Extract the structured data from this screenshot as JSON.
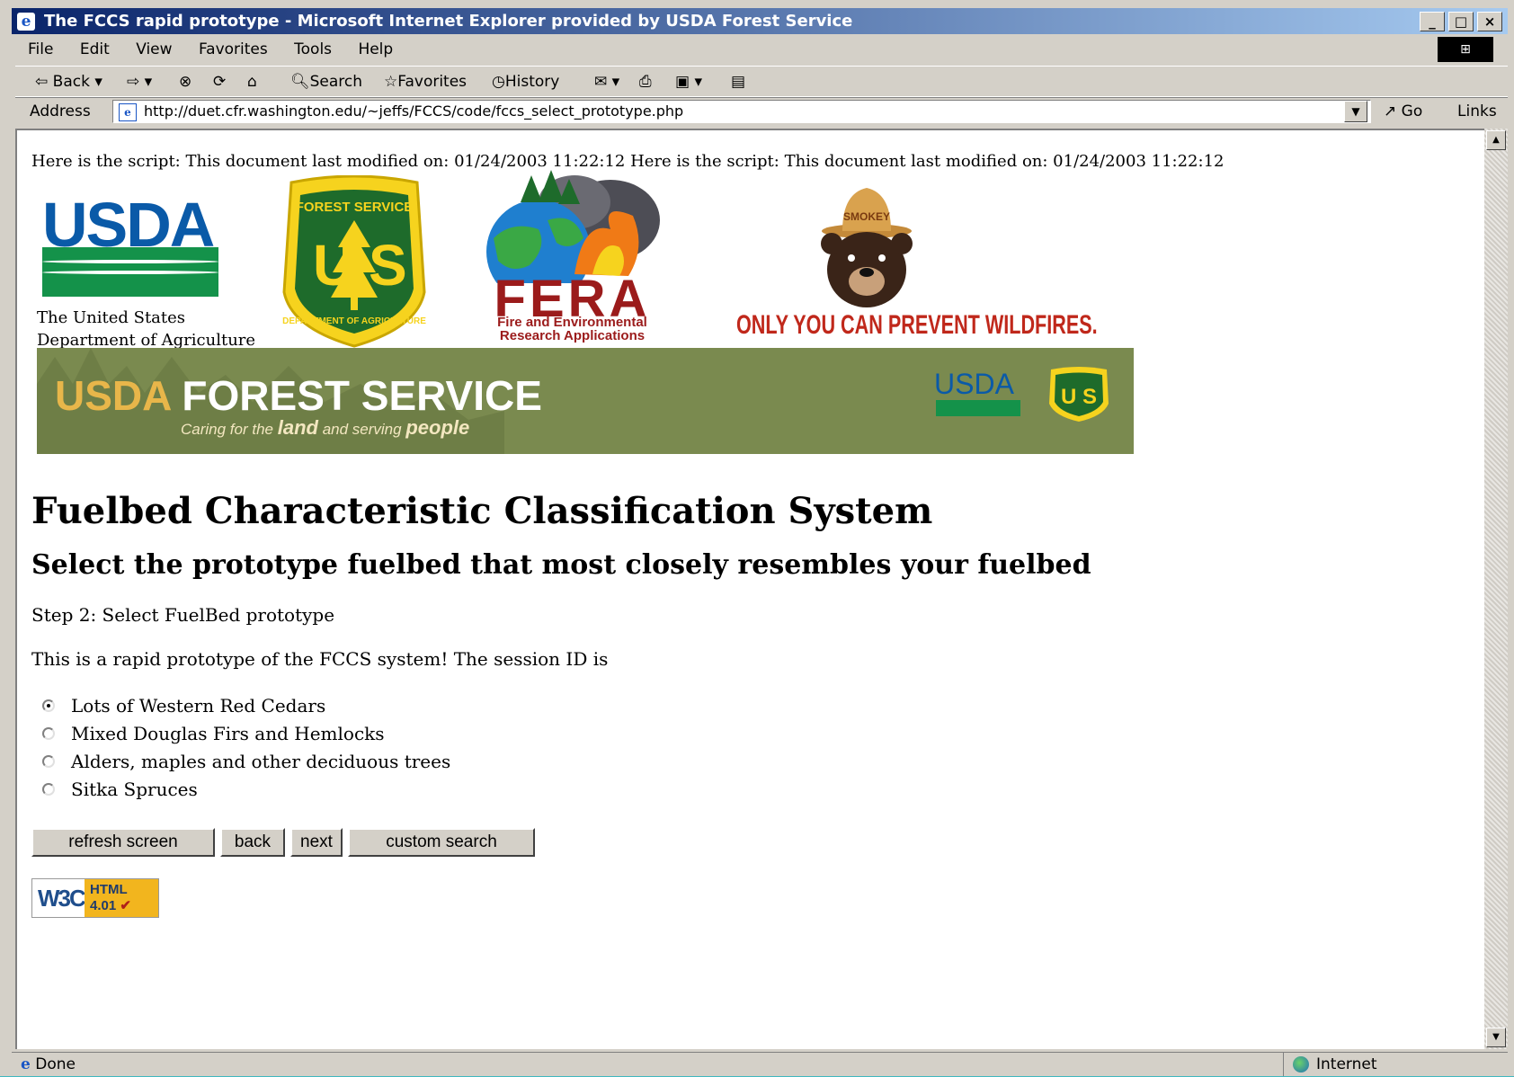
{
  "window": {
    "title": "The FCCS rapid prototype - Microsoft Internet Explorer provided by USDA Forest Service",
    "controls": [
      "_",
      "□",
      "×"
    ]
  },
  "menu": [
    "File",
    "Edit",
    "View",
    "Favorites",
    "Tools",
    "Help"
  ],
  "toolbar": {
    "back": "Back",
    "search": "Search",
    "favorites": "Favorites",
    "history": "History"
  },
  "address": {
    "label": "Address",
    "url": "http://duet.cfr.washington.edu/~jeffs/FCCS/code/fccs_select_prototype.php",
    "go": "Go",
    "links": "Links"
  },
  "page": {
    "modified_line": "Here is the script: This document last modified on: 01/24/2003 11:22:12 Here is the script: This document last modified on: 01/24/2003 11:22:12",
    "usda_logo": "USDA",
    "usda_caption_1": "The United States",
    "usda_caption_2": "Department of Agriculture",
    "fs_shield_top": "FOREST SERVICE",
    "fs_shield_bottom": "DEPARTMENT OF AGRICULTURE",
    "fera_word": "FERA",
    "fera_sub_1": "Fire and Environmental",
    "fera_sub_2": "Research Applications",
    "smokey_hat": "SMOKEY",
    "smokey_slogan": "ONLY YOU CAN PREVENT WILDFIRES.",
    "banner_usda": "USDA",
    "banner_fs": "FOREST SERVICE",
    "banner_tag_1": "Caring for the",
    "banner_tag_2": "land",
    "banner_tag_3": "and serving",
    "banner_tag_4": "people",
    "banner_logo_usda": "USDA",
    "title": "Fuelbed Characteristic Classification System",
    "subtitle": "Select the prototype fuelbed that most closely resembles your fuelbed",
    "step": "Step 2: Select FuelBed prototype",
    "session": "This is a rapid prototype of the FCCS system! The session ID is",
    "options": [
      {
        "label": "Lots of Western Red Cedars",
        "checked": true
      },
      {
        "label": "Mixed Douglas Firs and Hemlocks",
        "checked": false
      },
      {
        "label": "Alders, maples and other deciduous trees",
        "checked": false
      },
      {
        "label": "Sitka Spruces",
        "checked": false
      }
    ],
    "buttons": {
      "refresh": "refresh screen",
      "back": "back",
      "next": "next",
      "custom": "custom search"
    },
    "w3c": {
      "w3c": "W3C",
      "html": "HTML",
      "version": "4.01"
    }
  },
  "status": {
    "text": "Done",
    "zone": "Internet"
  },
  "colors": {
    "titlebar_start": "#0a246a",
    "usda_blue": "#0a5aa8",
    "usda_green": "#14924a",
    "banner_green": "#7a8a4f",
    "fera_red": "#9b1b1b"
  }
}
